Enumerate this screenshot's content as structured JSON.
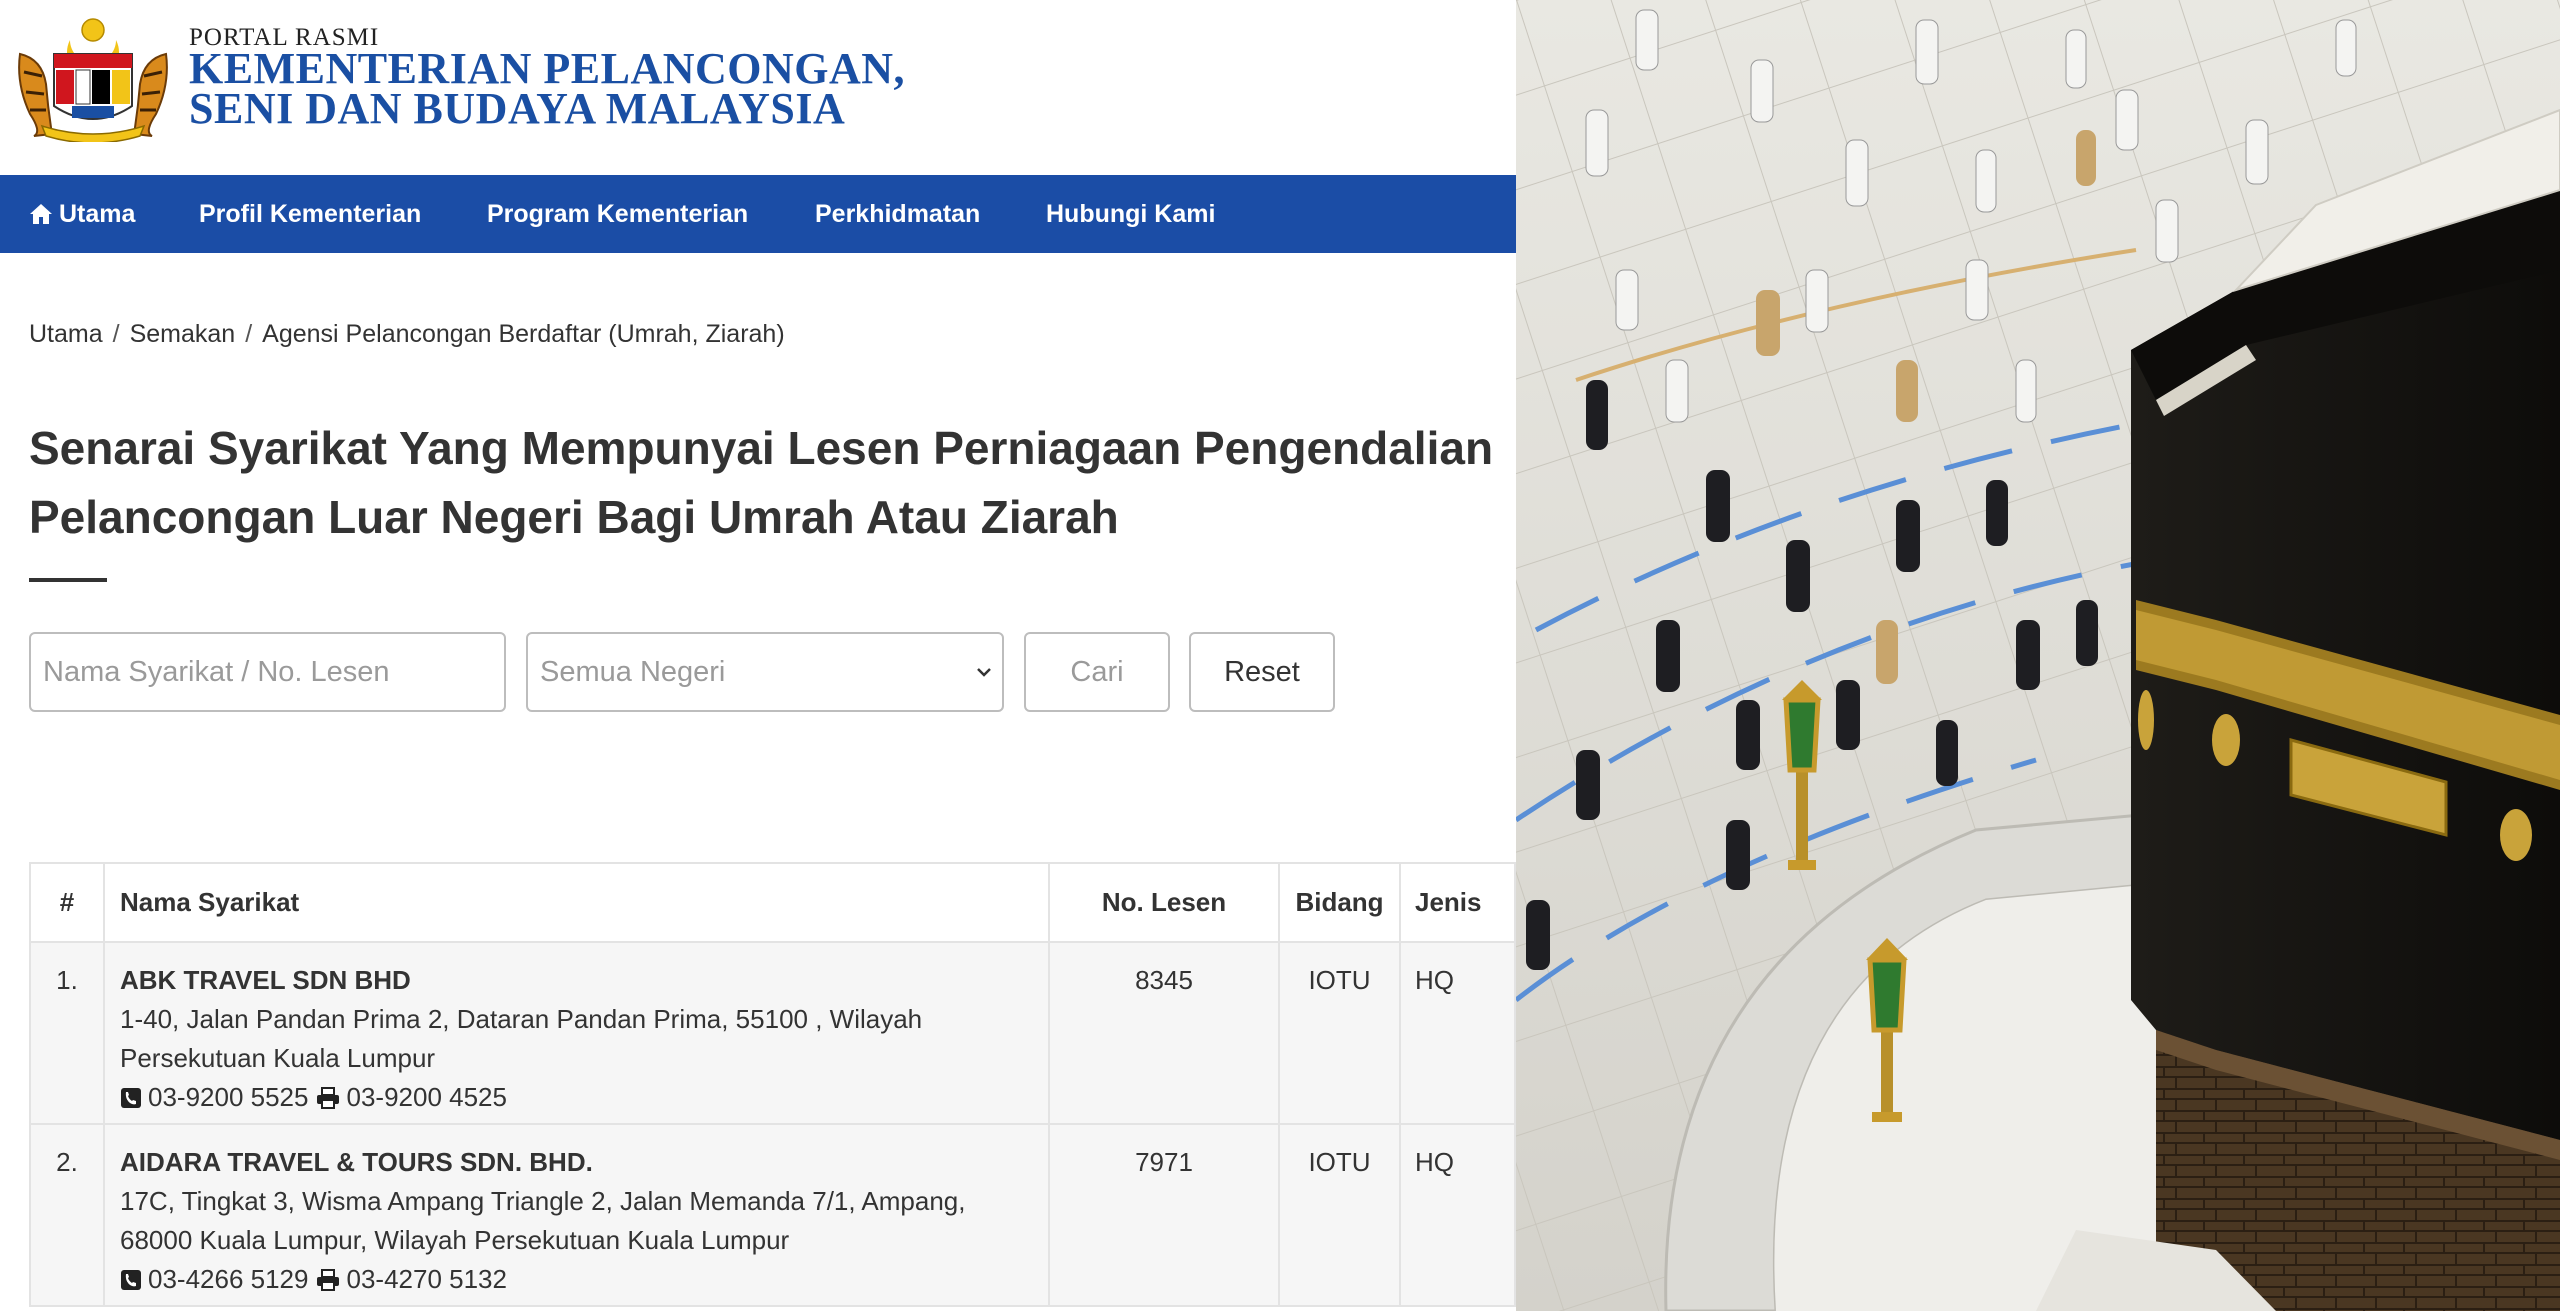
{
  "header": {
    "portal_label": "PORTAL RASMI",
    "ministry_line1": "KEMENTERIAN PELANCONGAN,",
    "ministry_line2": "SENI DAN BUDAYA MALAYSIA",
    "crest_icon": "malaysia-coat-of-arms-icon"
  },
  "nav": {
    "items": [
      {
        "label": "Utama",
        "icon": "home-icon"
      },
      {
        "label": "Profil Kementerian"
      },
      {
        "label": "Program Kementerian"
      },
      {
        "label": "Perkhidmatan"
      },
      {
        "label": "Hubungi Kami"
      }
    ]
  },
  "breadcrumb": [
    "Utama",
    "Semakan",
    "Agensi Pelancongan Berdaftar (Umrah, Ziarah)"
  ],
  "page": {
    "title_line1": "Senarai Syarikat Yang Mempunyai Lesen Perniagaan Pengendalian",
    "title_line2": "Pelancongan Luar Negeri Bagi Umrah Atau Ziarah"
  },
  "search": {
    "name_placeholder": "Nama Syarikat / No. Lesen",
    "state_selected": "Semua Negeri",
    "search_label": "Cari",
    "reset_label": "Reset"
  },
  "table": {
    "headers": {
      "num": "#",
      "name": "Nama Syarikat",
      "lesen": "No. Lesen",
      "bidang": "Bidang",
      "jenis": "Jenis"
    },
    "rows": [
      {
        "num": "1.",
        "name": "ABK TRAVEL SDN BHD",
        "address_line1": "1-40, Jalan Pandan Prima 2, Dataran Pandan Prima, 55100 , Wilayah",
        "address_line2": "Persekutuan Kuala Lumpur",
        "phone": "03-9200 5525",
        "fax": "03-9200 4525",
        "lesen": "8345",
        "bidang": "IOTU",
        "jenis": "HQ"
      },
      {
        "num": "2.",
        "name": "AIDARA TRAVEL & TOURS SDN. BHD.",
        "address_line1": "17C, Tingkat 3, Wisma Ampang Triangle 2, Jalan Memanda 7/1, Ampang,",
        "address_line2": "68000 Kuala Lumpur, Wilayah Persekutuan Kuala Lumpur",
        "phone": "03-4266 5129",
        "fax": "03-4270 5132",
        "lesen": "7971",
        "bidang": "IOTU",
        "jenis": "HQ"
      }
    ]
  },
  "colors": {
    "nav_bg": "#1b4da6",
    "ministry_text": "#1a4fa3"
  }
}
